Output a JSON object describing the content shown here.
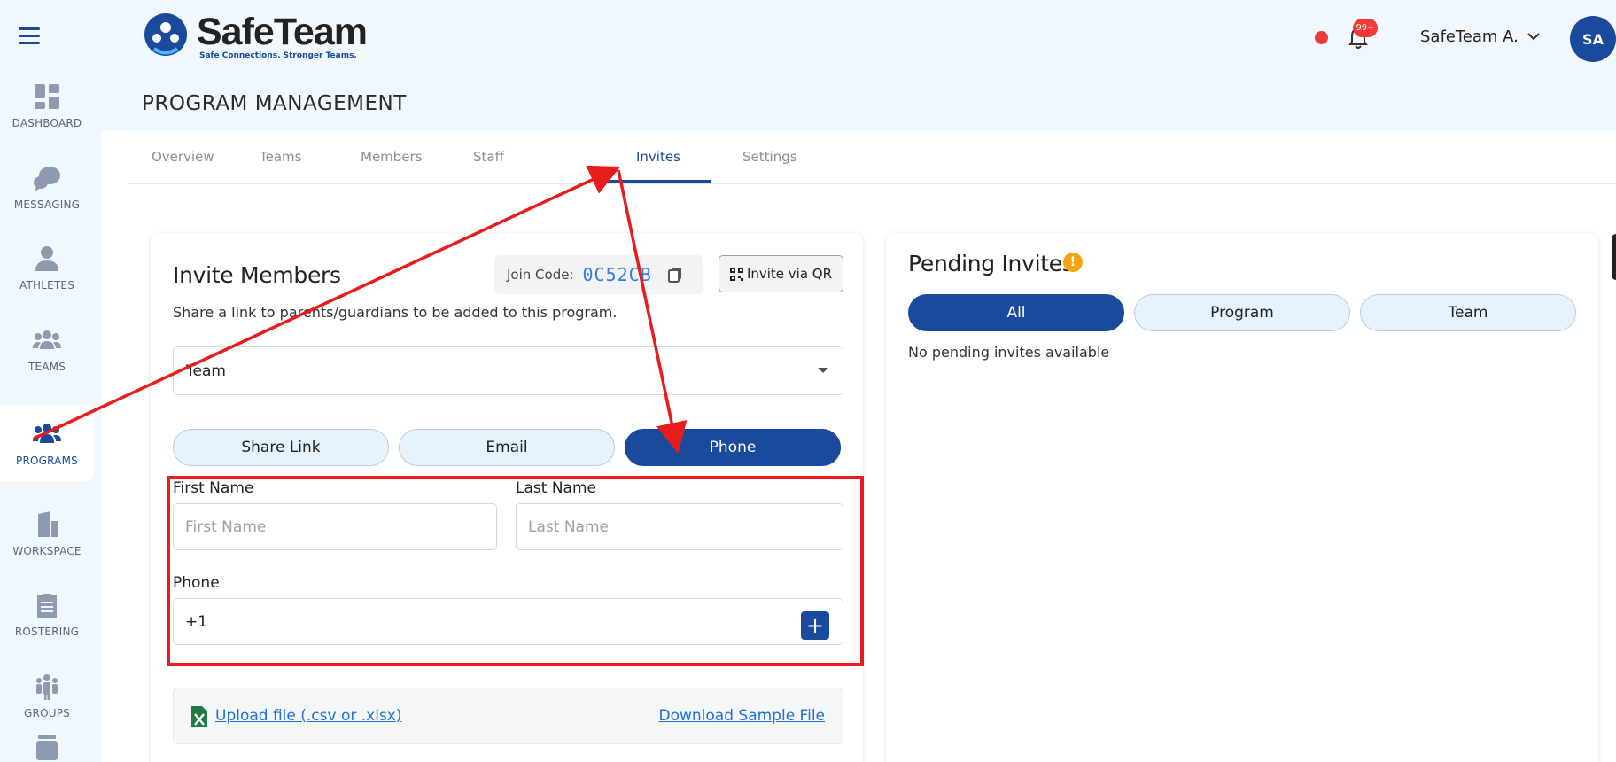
{
  "app": {
    "name": "SafeTeam",
    "tagline": "Safe Connections. Stronger Teams."
  },
  "page_title": "PROGRAM MANAGEMENT",
  "sidebar": {
    "items": [
      {
        "label": "DASHBOARD",
        "icon": "dashboard-icon"
      },
      {
        "label": "MESSAGING",
        "icon": "chat-bubbles-icon"
      },
      {
        "label": "ATHLETES",
        "icon": "person-icon"
      },
      {
        "label": "TEAMS",
        "icon": "team-icon"
      },
      {
        "label": "PROGRAMS",
        "icon": "programs-icon",
        "active": true
      },
      {
        "label": "WORKSPACE",
        "icon": "building-icon"
      },
      {
        "label": "ROSTERING",
        "icon": "clipboard-icon"
      },
      {
        "label": "GROUPS",
        "icon": "groups-icon"
      }
    ]
  },
  "header": {
    "notification_badge": "99+",
    "user_name": "SafeTeam A.",
    "avatar_initials": "SA"
  },
  "tabs": [
    {
      "label": "Overview"
    },
    {
      "label": "Teams"
    },
    {
      "label": "Members"
    },
    {
      "label": "Staff"
    },
    {
      "label": "Invites",
      "active": true
    },
    {
      "label": "Settings"
    }
  ],
  "invite": {
    "title": "Invite Members",
    "join_code_label": "Join Code:",
    "join_code": "0C52CB",
    "qr_button": "Invite via QR",
    "subtitle": "Share a link to parents/guardians to be added to this program.",
    "scope_select": "Team",
    "methods": [
      {
        "label": "Share Link"
      },
      {
        "label": "Email"
      },
      {
        "label": "Phone",
        "active": true
      }
    ],
    "first_name_label": "First Name",
    "first_name_placeholder": "First Name",
    "first_name_value": "",
    "last_name_label": "Last Name",
    "last_name_placeholder": "Last Name",
    "last_name_value": "",
    "phone_label": "Phone",
    "phone_value": "+1",
    "upload_link": "Upload file (.csv or .xlsx)",
    "sample_link": "Download Sample File"
  },
  "pending": {
    "title": "Pending Invites",
    "filters": [
      {
        "label": "All",
        "active": true
      },
      {
        "label": "Program"
      },
      {
        "label": "Team"
      }
    ],
    "empty_text": "No pending invites available"
  },
  "colors": {
    "primary": "#1a4a9b",
    "annotation": "#e81c1c",
    "warning": "#f4a414",
    "link": "#1e6fd9"
  }
}
